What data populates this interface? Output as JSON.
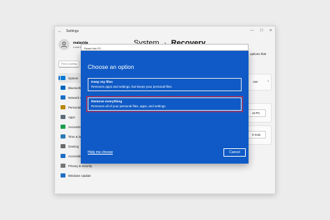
{
  "settings_window": {
    "title": "Settings",
    "back_glyph": "←",
    "controls": {
      "minimize": "—",
      "maximize": "☐",
      "close": "✕"
    },
    "profile": {
      "name": "malavida",
      "account_type": "Local Account"
    },
    "find_placeholder": "Find a setting",
    "breadcrumb": {
      "parent": "System",
      "separator": "›",
      "current": "Recovery"
    },
    "nav": [
      {
        "label": "System",
        "icon": "monitor-icon",
        "color": "#0078d4",
        "active": true
      },
      {
        "label": "Bluetooth & devices",
        "icon": "bluetooth-icon",
        "color": "#0067c0",
        "active": false
      },
      {
        "label": "Network & internet",
        "icon": "wifi-icon",
        "color": "#1a6fc4",
        "active": false
      },
      {
        "label": "Personalization",
        "icon": "brush-icon",
        "color": "#b8860b",
        "active": false
      },
      {
        "label": "Apps",
        "icon": "apps-icon",
        "color": "#5c6b7a",
        "active": false
      },
      {
        "label": "Accounts",
        "icon": "person-icon",
        "color": "#1b9e4b",
        "active": false
      },
      {
        "label": "Time & language",
        "icon": "clock-icon",
        "color": "#2a7ab8",
        "active": false
      },
      {
        "label": "Gaming",
        "icon": "gamepad-icon",
        "color": "#6b6b6b",
        "active": false
      },
      {
        "label": "Accessibility",
        "icon": "accessibility-icon",
        "color": "#1f6fc5",
        "active": false
      },
      {
        "label": "Privacy & security",
        "icon": "shield-icon",
        "color": "#777777",
        "active": false
      },
      {
        "label": "Windows Update",
        "icon": "update-icon",
        "color": "#1f6fc5",
        "active": false
      }
    ],
    "background_cards": {
      "options_text": "options that",
      "fragment_1": "",
      "troubleshooter_text": "oter",
      "reset_pc_button": "et PC",
      "restart_now_button": "rt now"
    }
  },
  "reset_dialog": {
    "window_title": "Reset this PC",
    "heading": "Choose an option",
    "options": [
      {
        "title": "Keep my files",
        "description": "Removes apps and settings, but keeps your personal files."
      },
      {
        "title": "Remove everything",
        "description": "Removes all of your personal files, apps, and settings."
      }
    ],
    "selected_option_index": 1,
    "help_link": "Help me choose",
    "cancel_button": "Cancel",
    "colors": {
      "background": "#0f5ac6",
      "highlight": "#e0263a"
    }
  }
}
